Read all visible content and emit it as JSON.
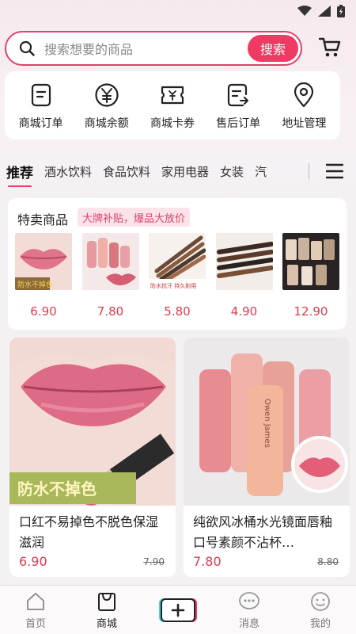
{
  "search": {
    "placeholder": "搜索想要的商品",
    "button_label": "搜索"
  },
  "quick_menu": [
    {
      "label": "商城订单",
      "icon": "order-icon"
    },
    {
      "label": "商城余额",
      "icon": "yuan-icon"
    },
    {
      "label": "商城卡券",
      "icon": "coupon-icon"
    },
    {
      "label": "售后订单",
      "icon": "after-sale-icon"
    },
    {
      "label": "地址管理",
      "icon": "location-icon"
    }
  ],
  "categories": [
    "推荐",
    "酒水饮料",
    "食品饮料",
    "家用电器",
    "女装",
    "汽"
  ],
  "flash_sale": {
    "title": "特卖商品",
    "badge": "大牌补贴，爆品大放价",
    "items": [
      {
        "price": "6.90",
        "tag": "防水不掉色"
      },
      {
        "price": "7.80"
      },
      {
        "price": "5.80",
        "tag": "防水抗汗 持久耐用"
      },
      {
        "price": "4.90"
      },
      {
        "price": "12.90"
      }
    ]
  },
  "products": [
    {
      "title": "口红不易掉色不脱色保湿滋润",
      "price": "6.90",
      "old_price": "7.90",
      "img_caption": "防水不掉色"
    },
    {
      "title": "纯欲风冰桶水光镜面唇釉口号素颜不沾杯…",
      "price": "7.80",
      "old_price": "8.80",
      "brand": "Owen James"
    }
  ],
  "tab_bar": [
    {
      "label": "首页",
      "icon": "home-icon"
    },
    {
      "label": "商城",
      "icon": "shop-icon"
    },
    {
      "label": "",
      "icon": "plus-icon"
    },
    {
      "label": "消息",
      "icon": "message-icon"
    },
    {
      "label": "我的",
      "icon": "profile-icon"
    }
  ],
  "colors": {
    "accent": "#f03a63",
    "price": "#e03a4e"
  }
}
